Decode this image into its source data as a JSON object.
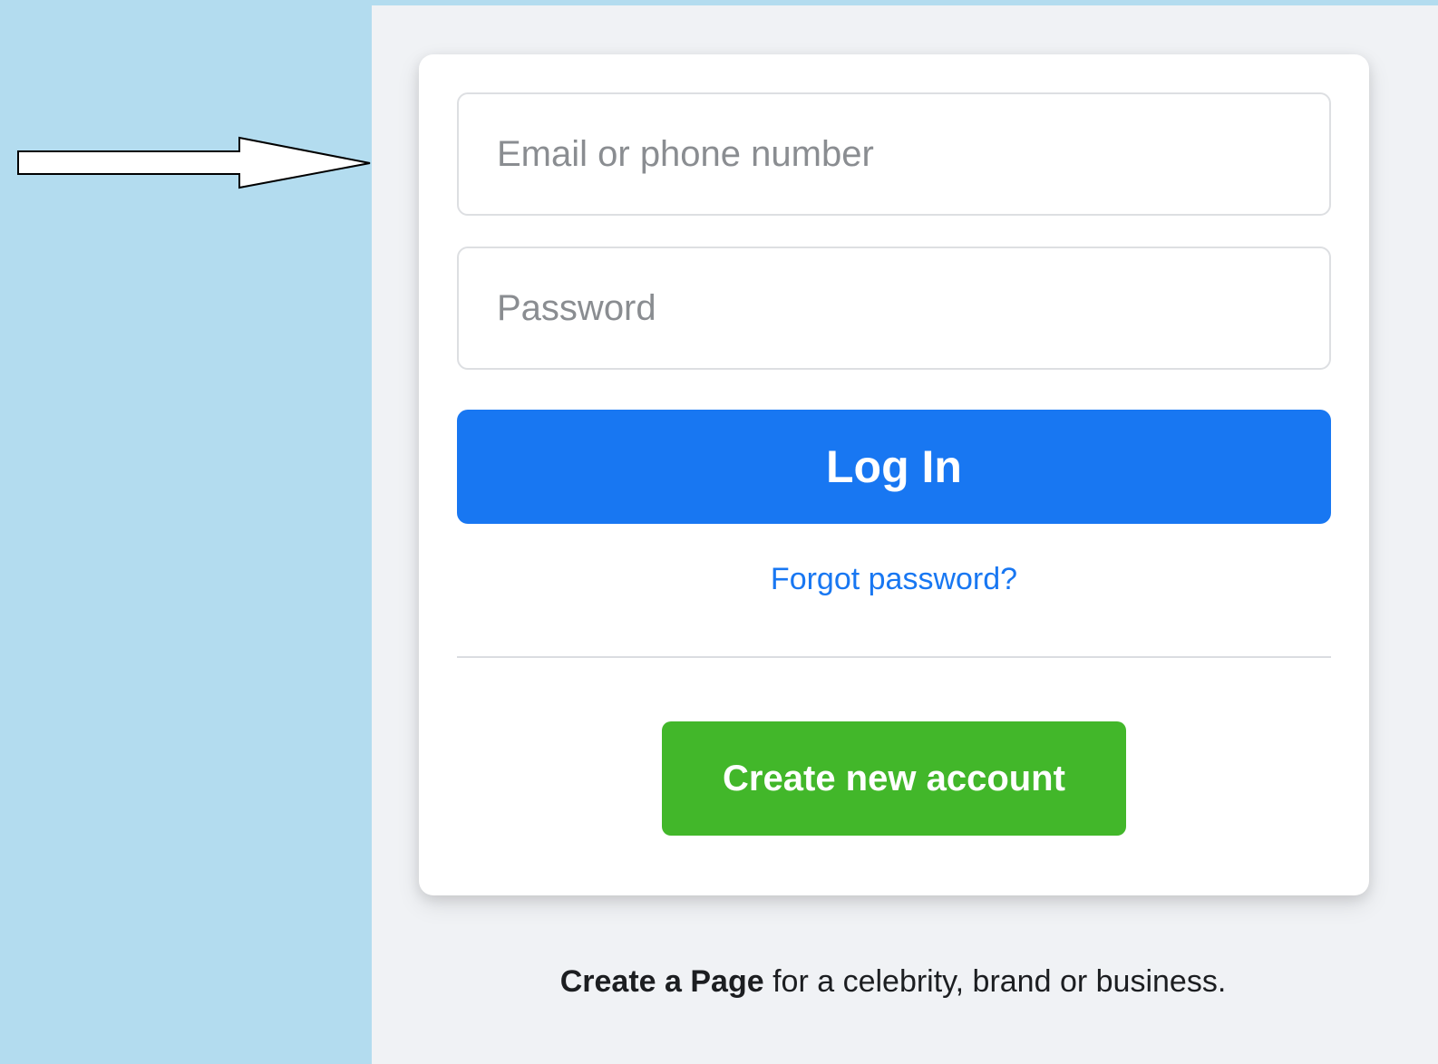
{
  "login_form": {
    "email_placeholder": "Email or phone number",
    "email_value": "",
    "password_placeholder": "Password",
    "password_value": "",
    "login_label": "Log In",
    "forgot_password_label": "Forgot password?",
    "create_account_label": "Create new account"
  },
  "footer": {
    "create_page_label": "Create a Page",
    "create_page_suffix": " for a celebrity, brand or business."
  },
  "annotation": {
    "arrow_icon": "right-arrow-icon"
  },
  "colors": {
    "outer_background": "#b3dcef",
    "page_background": "#f0f2f5",
    "login_blue": "#1877f2",
    "create_green": "#42b72a"
  }
}
